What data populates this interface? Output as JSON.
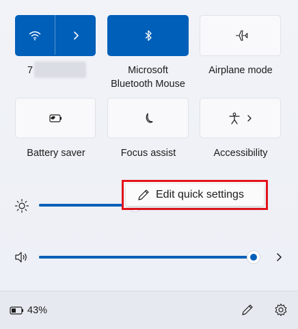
{
  "tiles": [
    {
      "label": "7",
      "state": "on",
      "icon": "wifi-icon",
      "expand_icon": "chevron-right-icon"
    },
    {
      "label": "Microsoft Bluetooth Mouse",
      "label_line1": "Microsoft",
      "label_line2": "Bluetooth Mouse",
      "state": "on",
      "icon": "bluetooth-icon"
    },
    {
      "label": "Airplane mode",
      "state": "off",
      "icon": "airplane-icon"
    },
    {
      "label": "Battery saver",
      "state": "off",
      "icon": "battery-saver-icon"
    },
    {
      "label": "Focus assist",
      "state": "off",
      "icon": "moon-icon"
    },
    {
      "label": "Accessibility",
      "state": "off",
      "icon": "accessibility-icon",
      "expand_icon": "chevron-right-icon"
    }
  ],
  "brightness": {
    "icon": "sun-icon",
    "level": 0.45
  },
  "volume": {
    "icon": "speaker-icon",
    "level": 1.0,
    "expand_icon": "chevron-right-icon"
  },
  "tooltip": {
    "text": "Edit quick settings",
    "icon": "pencil-icon"
  },
  "footer": {
    "battery_text": "43%",
    "battery_icon": "battery-icon",
    "edit_icon": "pencil-icon",
    "settings_icon": "gear-icon"
  },
  "colors": {
    "accent": "#005fb8",
    "highlight_border": "#e3141a"
  }
}
